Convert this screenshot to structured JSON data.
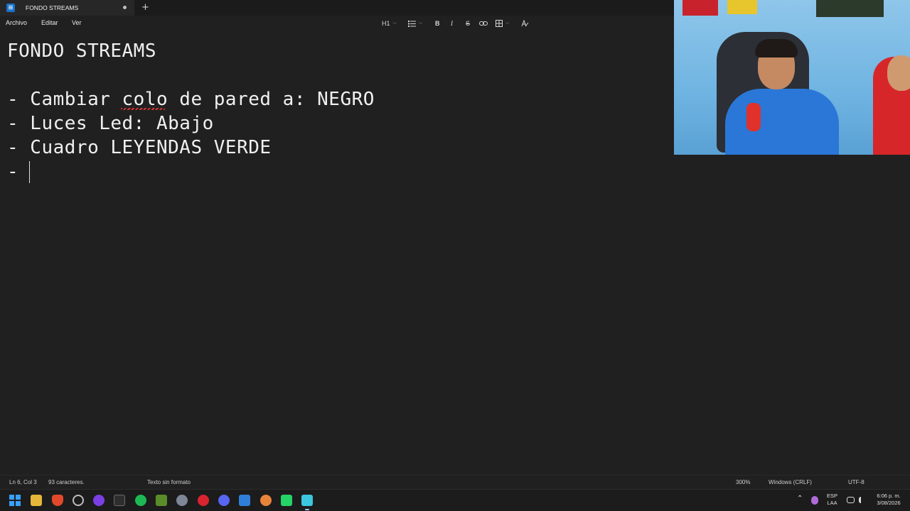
{
  "window": {
    "tab_title": "FONDO STREAMS",
    "new_tab_glyph": "+"
  },
  "menu": {
    "archivo": "Archivo",
    "editar": "Editar",
    "ver": "Ver"
  },
  "toolbar": {
    "heading": "H1",
    "bold": "B",
    "italic": "I",
    "strike": "S",
    "chevron": "⌵"
  },
  "document": {
    "lines": [
      "FONDO STREAMS",
      "",
      "- Cambiar colo de pared a: NEGRO",
      "- Luces Led: Abajo",
      "- Cuadro LEYENDAS VERDE",
      "- "
    ]
  },
  "status": {
    "position": "Ln 6, Col 3",
    "chars": "93 caracteres.",
    "format": "Texto sin formato",
    "zoom": "300%",
    "line_endings": "Windows (CRLF)",
    "encoding": "UTF-8"
  },
  "taskbar": {
    "lang_top": "ESP",
    "lang_bottom": "LAA",
    "time": "6:06 p. m.",
    "date": "3/08/2026",
    "icons": [
      "windows-start-icon",
      "file-explorer-icon",
      "brave-icon",
      "chrome-like-icon",
      "obs-icon",
      "terminal-icon",
      "spotify-icon",
      "nvidia-icon",
      "settings-icon",
      "app-red-icon",
      "discord-icon",
      "app-blue-icon",
      "app-orange-icon",
      "whatsapp-icon",
      "notepad-icon"
    ]
  },
  "colors": {
    "background": "#202020",
    "accent": "#1a73c9"
  }
}
